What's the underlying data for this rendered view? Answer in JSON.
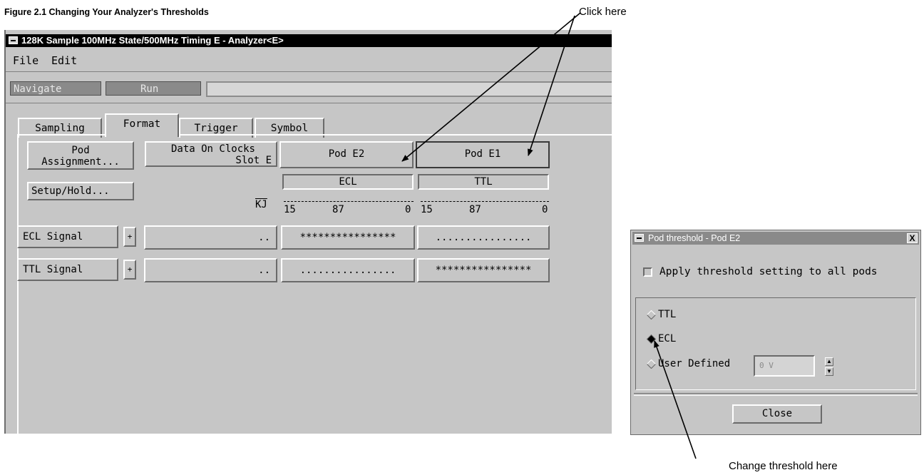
{
  "figure_caption": "Figure 2.1 Changing Your Analyzer's Thresholds",
  "callout_click": "Click here",
  "callout_change": "Change threshold here",
  "window": {
    "title": "128K Sample 100MHz State/500MHz Timing E - Analyzer<E>",
    "menu": [
      "File",
      "Edit"
    ],
    "toolbar": {
      "navigate": "Navigate",
      "run": "Run"
    },
    "tabs": [
      "Sampling",
      "Format",
      "Trigger",
      "Symbol"
    ],
    "pod_assignment": [
      "Pod",
      "Assignment..."
    ],
    "setup_hold": "Setup/Hold...",
    "data_on_clocks": [
      "Data On Clocks",
      "Slot E"
    ],
    "pods": [
      {
        "name": "Pod E2",
        "threshold": "ECL"
      },
      {
        "name": "Pod E1",
        "threshold": "TTL"
      }
    ],
    "header_kj": "KJ",
    "bit_scale": {
      "left": "15",
      "mid": "87",
      "right": "0"
    },
    "signals": [
      {
        "name": "ECL Signal",
        "expand": "+",
        "clk": "..",
        "pod_e2": "****************",
        "pod_e1": "................"
      },
      {
        "name": "TTL Signal",
        "expand": "+",
        "clk": "..",
        "pod_e2": "................",
        "pod_e1": "****************"
      }
    ]
  },
  "dialog": {
    "title": "Pod threshold - Pod E2",
    "close_x": "X",
    "apply_all": "Apply threshold setting to all pods",
    "options": [
      "TTL",
      "ECL",
      "User Defined"
    ],
    "selected": "ECL",
    "user_value": "0 V",
    "close": "Close"
  }
}
